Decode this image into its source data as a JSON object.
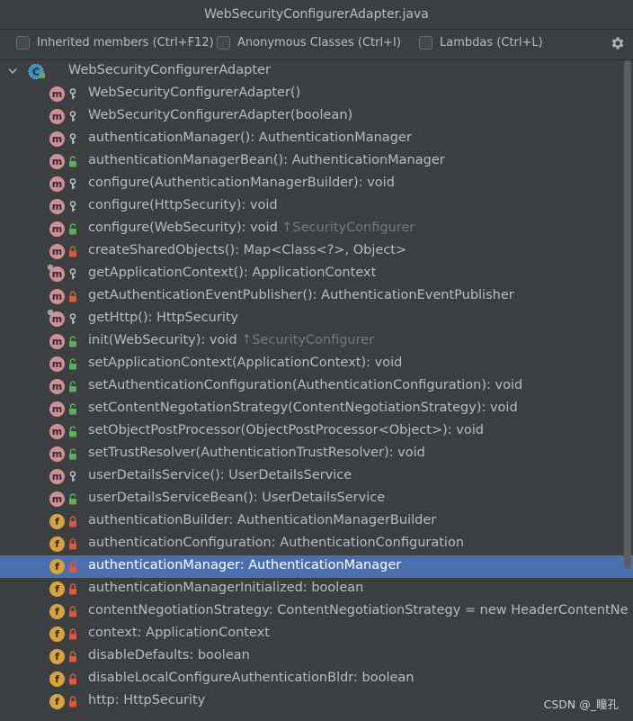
{
  "window": {
    "title": "WebSecurityConfigurerAdapter.java"
  },
  "toolbar": {
    "options": [
      {
        "label": "Inherited members (Ctrl+F12)",
        "checked": false
      },
      {
        "label": "Anonymous Classes (Ctrl+I)",
        "checked": false
      },
      {
        "label": "Lambdas (Ctrl+L)",
        "checked": false
      }
    ],
    "settings_icon": "gear-icon"
  },
  "tree": {
    "root": {
      "label": "WebSecurityConfigurerAdapter",
      "expanded": true,
      "icon": "abstract-class-icon"
    },
    "selected_index": 21,
    "items": [
      {
        "kind": "m",
        "vis": "protected",
        "text": "WebSecurityConfigurerAdapter()",
        "hint": ""
      },
      {
        "kind": "m",
        "vis": "protected",
        "text": "WebSecurityConfigurerAdapter(boolean)",
        "hint": ""
      },
      {
        "kind": "m",
        "vis": "protected",
        "text": "authenticationManager(): AuthenticationManager",
        "hint": ""
      },
      {
        "kind": "m",
        "vis": "public",
        "text": "authenticationManagerBean(): AuthenticationManager",
        "hint": ""
      },
      {
        "kind": "m",
        "vis": "protected",
        "text": "configure(AuthenticationManagerBuilder): void",
        "hint": ""
      },
      {
        "kind": "m",
        "vis": "protected",
        "text": "configure(HttpSecurity): void",
        "hint": ""
      },
      {
        "kind": "m",
        "vis": "public",
        "text": "configure(WebSecurity): void ",
        "hint": "↑SecurityConfigurer"
      },
      {
        "kind": "m",
        "vis": "private",
        "text": "createSharedObjects(): Map<Class<?>, Object>",
        "hint": ""
      },
      {
        "kind": "m",
        "vis": "protected",
        "final": true,
        "text": "getApplicationContext(): ApplicationContext",
        "hint": ""
      },
      {
        "kind": "m",
        "vis": "private",
        "text": "getAuthenticationEventPublisher(): AuthenticationEventPublisher",
        "hint": ""
      },
      {
        "kind": "m",
        "vis": "protected",
        "final": true,
        "text": "getHttp(): HttpSecurity",
        "hint": ""
      },
      {
        "kind": "m",
        "vis": "public",
        "text": "init(WebSecurity): void ",
        "hint": "↑SecurityConfigurer"
      },
      {
        "kind": "m",
        "vis": "public",
        "text": "setApplicationContext(ApplicationContext): void",
        "hint": ""
      },
      {
        "kind": "m",
        "vis": "public",
        "text": "setAuthenticationConfiguration(AuthenticationConfiguration): void",
        "hint": ""
      },
      {
        "kind": "m",
        "vis": "public",
        "text": "setContentNegotationStrategy(ContentNegotiationStrategy): void",
        "hint": ""
      },
      {
        "kind": "m",
        "vis": "public",
        "text": "setObjectPostProcessor(ObjectPostProcessor<Object>): void",
        "hint": ""
      },
      {
        "kind": "m",
        "vis": "public",
        "text": "setTrustResolver(AuthenticationTrustResolver): void",
        "hint": ""
      },
      {
        "kind": "m",
        "vis": "protected",
        "text": "userDetailsService(): UserDetailsService",
        "hint": ""
      },
      {
        "kind": "m",
        "vis": "public",
        "text": "userDetailsServiceBean(): UserDetailsService",
        "hint": ""
      },
      {
        "kind": "f",
        "vis": "private",
        "text": "authenticationBuilder: AuthenticationManagerBuilder",
        "hint": ""
      },
      {
        "kind": "f",
        "vis": "private",
        "text": "authenticationConfiguration: AuthenticationConfiguration",
        "hint": ""
      },
      {
        "kind": "f",
        "vis": "private",
        "text": "authenticationManager: AuthenticationManager",
        "hint": ""
      },
      {
        "kind": "f",
        "vis": "private",
        "text": "authenticationManagerInitialized: boolean",
        "hint": ""
      },
      {
        "kind": "f",
        "vis": "private",
        "text": "contentNegotiationStrategy: ContentNegotiationStrategy = new HeaderContentNe",
        "hint": ""
      },
      {
        "kind": "f",
        "vis": "private",
        "text": "context: ApplicationContext",
        "hint": ""
      },
      {
        "kind": "f",
        "vis": "private",
        "text": "disableDefaults: boolean",
        "hint": ""
      },
      {
        "kind": "f",
        "vis": "private",
        "text": "disableLocalConfigureAuthenticationBldr: boolean",
        "hint": ""
      },
      {
        "kind": "f",
        "vis": "private",
        "text": "http: HttpSecurity",
        "hint": ""
      }
    ]
  },
  "watermark": "CSDN @_瞳孔",
  "colors": {
    "background": "#3c3f41",
    "selection": "#4b6eaf",
    "method_icon": "#d08e97",
    "field_icon": "#d8a33d",
    "public_lock": "#5fad56",
    "private_lock": "#e0573d"
  }
}
